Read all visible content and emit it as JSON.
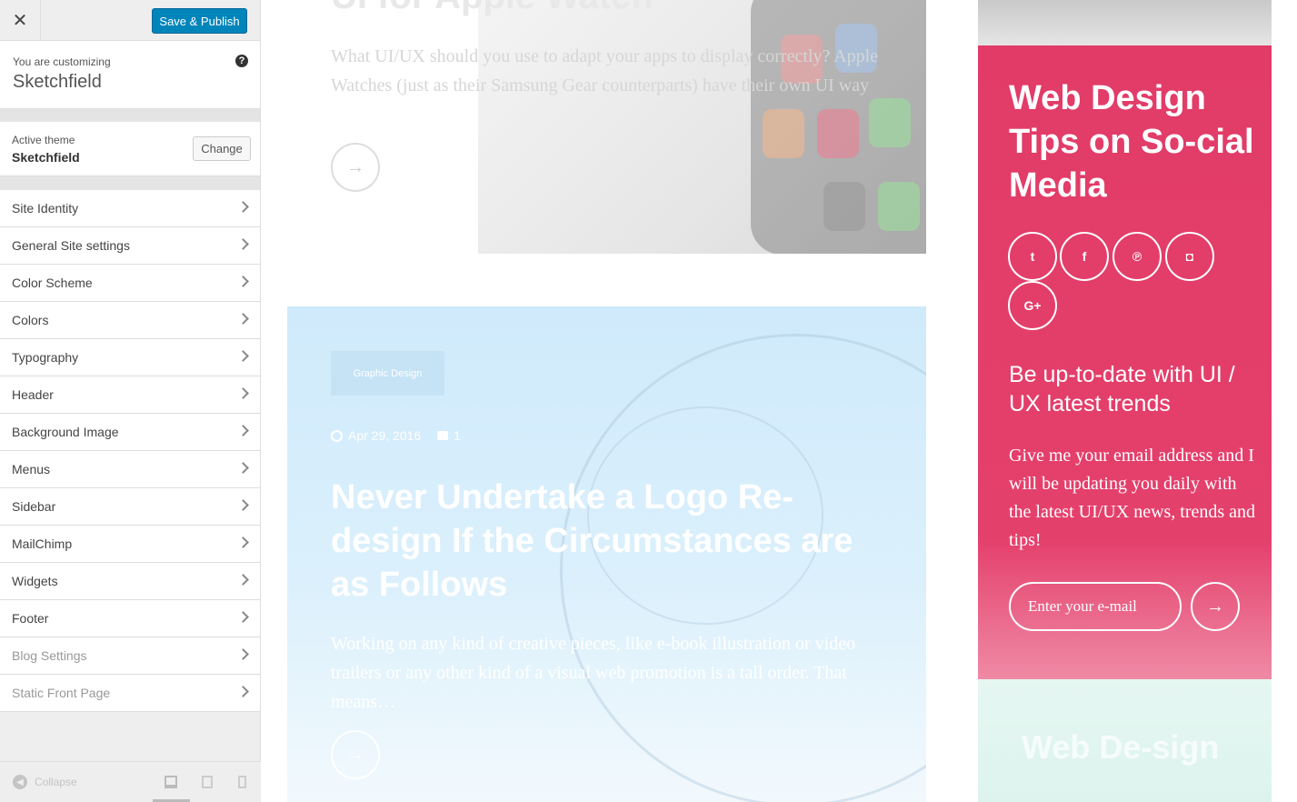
{
  "customizer": {
    "close_icon": "close-icon",
    "save_label": "Save & Publish",
    "customizing_label": "You are customizing",
    "site_name": "Sketchfield",
    "help_icon": "?",
    "active_theme_label": "Active theme",
    "active_theme_name": "Sketchfield",
    "change_label": "Change",
    "sections": [
      {
        "label": "Site Identity"
      },
      {
        "label": "General Site settings"
      },
      {
        "label": "Color Scheme"
      },
      {
        "label": "Colors"
      },
      {
        "label": "Typography"
      },
      {
        "label": "Header"
      },
      {
        "label": "Background Image"
      },
      {
        "label": "Menus"
      },
      {
        "label": "Sidebar"
      },
      {
        "label": "MailChimp"
      },
      {
        "label": "Widgets"
      },
      {
        "label": "Footer"
      },
      {
        "label": "Blog Settings"
      },
      {
        "label": "Static Front Page"
      }
    ],
    "collapse_label": "Collapse",
    "accent": "#0085ba"
  },
  "preview": {
    "post1": {
      "title": "UI for Apple Watch",
      "excerpt": "What UI/UX should you use to adapt your apps to display correctly? Apple Watches (just as their Samsung Gear counterparts) have their own UI way",
      "arrow": "→"
    },
    "post2": {
      "category": "Graphic Design",
      "date": "Apr 29, 2016",
      "comments": "1",
      "title": "Never Undertake a Logo Re-design If the Circumstances are as Follows",
      "excerpt": "Working on any kind of creative pieces, like e-book illustration or video trailers or any other kind of a visual web promotion is a tall order. That means…",
      "arrow": "→"
    },
    "widget": {
      "title": "Web Design Tips on So-cial Media",
      "social": [
        {
          "icon": "twitter-icon",
          "glyph": "t"
        },
        {
          "icon": "facebook-icon",
          "glyph": "f"
        },
        {
          "icon": "pinterest-icon",
          "glyph": "℗"
        },
        {
          "icon": "instagram-icon",
          "glyph": "◘"
        },
        {
          "icon": "google-plus-icon",
          "glyph": "G+"
        }
      ],
      "subtitle": "Be up-to-date with UI / UX latest trends",
      "text": "Give me your email address and I will be updating you daily with the latest UI/UX news, trends and tips!",
      "email_placeholder": "Enter your e-mail",
      "submit": "→",
      "color": "#e23b67"
    },
    "post3": {
      "title": "Web De-sign"
    }
  }
}
